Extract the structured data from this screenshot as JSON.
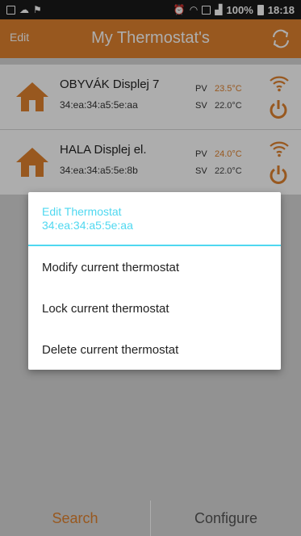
{
  "status_bar": {
    "battery": "100%",
    "time": "18:18"
  },
  "app_bar": {
    "edit_label": "Edit",
    "title": "My Thermostat's"
  },
  "devices": [
    {
      "name": "OBYVÁK Displej 7",
      "mac": "34:ea:34:a5:5e:aa",
      "pv_label": "PV",
      "pv_value": "23.5°C",
      "sv_label": "SV",
      "sv_value": "22.0°C"
    },
    {
      "name": "HALA Displej el.",
      "mac": "34:ea:34:a5:5e:8b",
      "pv_label": "PV",
      "pv_value": "24.0°C",
      "sv_label": "SV",
      "sv_value": "22.0°C"
    }
  ],
  "dialog": {
    "title": "Edit Thermostat",
    "subtitle": "34:ea:34:a5:5e:aa",
    "items": [
      "Modify current thermostat",
      "Lock current thermostat",
      "Delete current thermostat"
    ]
  },
  "bottom": {
    "search_label": "Search",
    "configure_label": "Configure"
  },
  "colors": {
    "accent": "#e0822e",
    "dialog_accent": "#4fd8f0",
    "list_bg": "#d8d8d8"
  },
  "icons": [
    "house-icon",
    "wifi-icon",
    "power-icon",
    "refresh-icon"
  ]
}
